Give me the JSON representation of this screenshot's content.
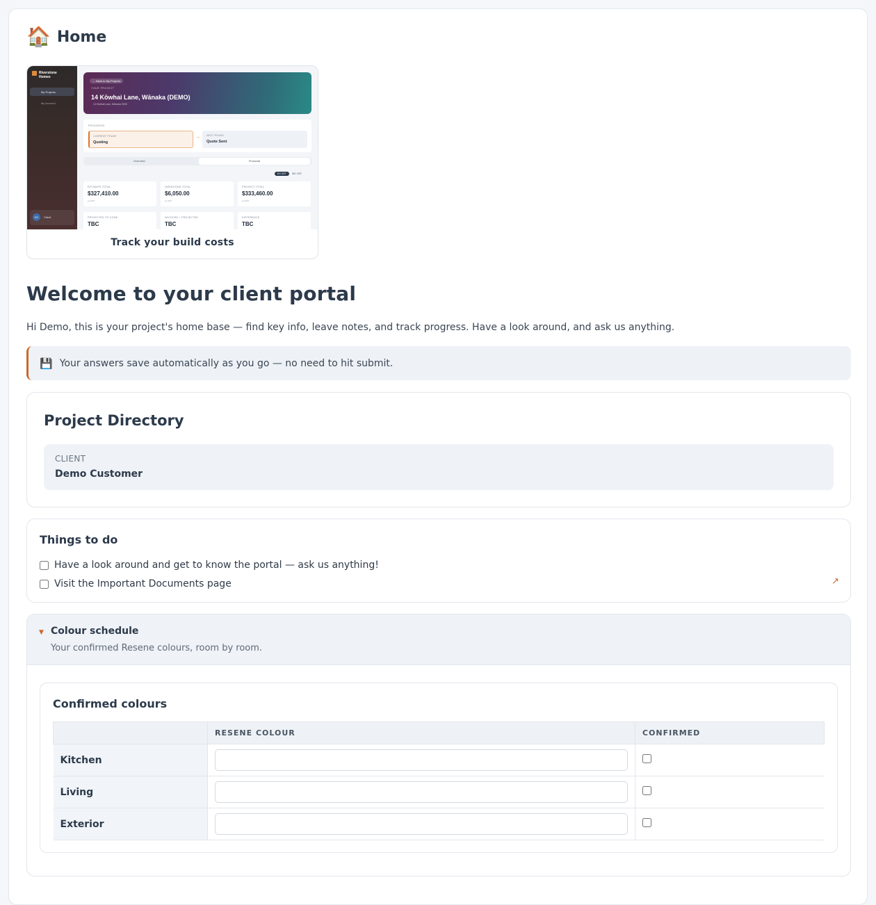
{
  "page": {
    "icon": "house-icon",
    "title": "Home"
  },
  "preview": {
    "caption": "Track your build costs",
    "brand": "Riverstone Homes",
    "nav": [
      "My Projects",
      "My Account"
    ],
    "back_label": "← Back to My Projects",
    "project_label": "YOUR PROJECT",
    "project_name": "14 Kōwhai Lane, Wānaka (DEMO)",
    "project_address": "14 Kōwhai Lane, Wānaka 9305",
    "progress_label": "PROGRESS",
    "current_phase_label": "CURRENT PHASE",
    "current_phase": "Quoting",
    "next_phase_label": "NEXT PHASE",
    "next_phase": "Quote Sent",
    "tabs": [
      "Overview",
      "Financial"
    ],
    "gst_toggle": [
      "EX GST",
      "INC GST"
    ],
    "tiles": [
      {
        "label": "ESTIMATE TOTAL",
        "value": "$327,410.00",
        "note": "ex GST"
      },
      {
        "label": "VARIATIONS TOTAL",
        "value": "$6,050.00",
        "note": "ex GST"
      },
      {
        "label": "PROJECT TOTAL",
        "value": "$333,460.00",
        "note": "ex GST"
      },
      {
        "label": "PROJECTED TO COME",
        "value": "TBC",
        "note": ""
      },
      {
        "label": "INVOICED + PROJECTED",
        "value": "TBC",
        "note": ""
      },
      {
        "label": "DIFFERENCE",
        "value": "TBC",
        "note": ""
      }
    ],
    "user_initials": "DC",
    "user_name": "Client"
  },
  "welcome": {
    "heading": "Welcome to your client portal",
    "intro": "Hi Demo, this is your project's home base — find key info, leave notes, and track progress. Have a look around, and ask us anything."
  },
  "notice": {
    "icon": "floppy-disk-icon",
    "text": "Your answers save automatically as you go — no need to hit submit."
  },
  "directory": {
    "title": "Project Directory",
    "client_label": "CLIENT",
    "client_value": "Demo Customer"
  },
  "todo": {
    "title": "Things to do",
    "items": [
      {
        "label": "Have a look around and get to know the portal — ask us anything!",
        "checked": false
      },
      {
        "label": "Visit the Important Documents page",
        "checked": false
      }
    ]
  },
  "schedule": {
    "title": "Colour schedule",
    "subtitle": "Your confirmed Resene colours, room by room.",
    "card_title": "Confirmed colours",
    "columns": [
      "",
      "RESENE COLOUR",
      "CONFIRMED"
    ],
    "rows": [
      {
        "room": "Kitchen",
        "colour": "",
        "confirmed": false
      },
      {
        "room": "Living",
        "colour": "",
        "confirmed": false
      },
      {
        "room": "Exterior",
        "colour": "",
        "confirmed": false
      }
    ]
  },
  "colors": {
    "accent": "#c9692a",
    "heading": "#2c3a4b",
    "panel": "#eff2f6"
  }
}
